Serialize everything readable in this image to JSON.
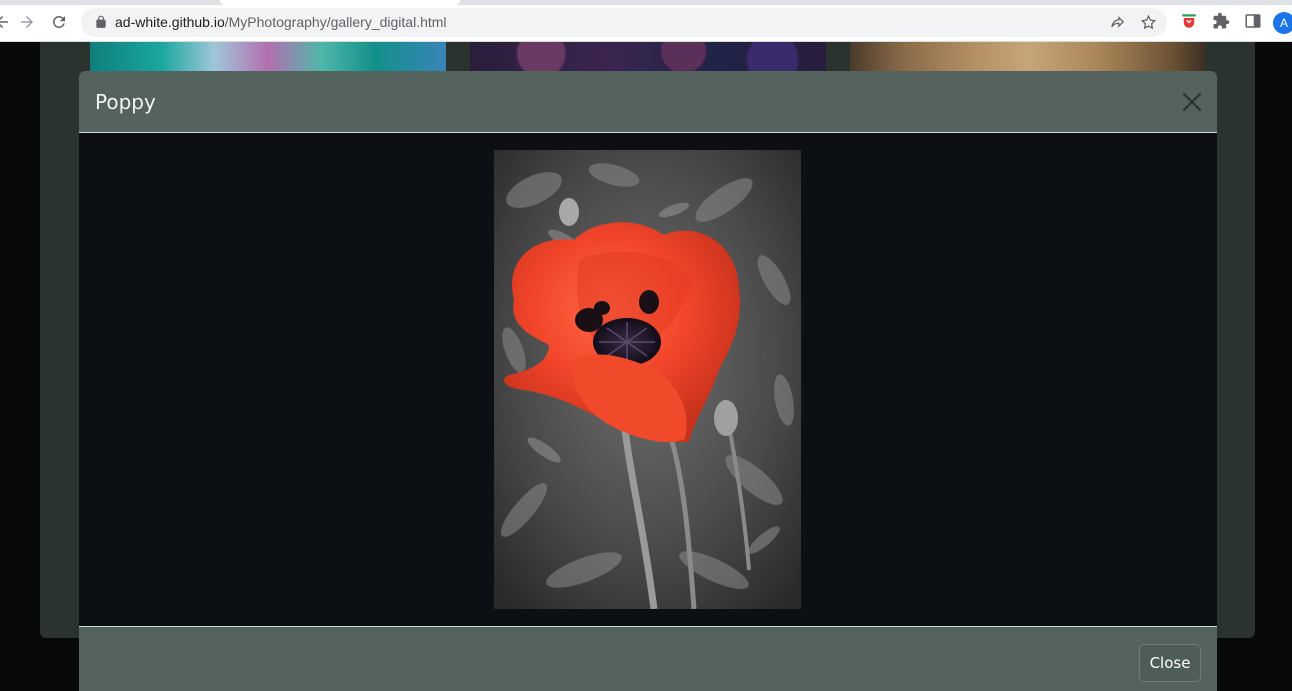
{
  "browser": {
    "url_host": "ad-white.github.io",
    "url_path": "/MyPhotography/gallery_digital.html",
    "profile_initial": "A",
    "icons": [
      "back-icon",
      "forward-icon",
      "reload-icon",
      "lock-icon",
      "share-icon",
      "bookmark-star-icon",
      "extension-shield-icon",
      "extensions-puzzle-icon",
      "side-panel-icon"
    ]
  },
  "modal": {
    "title": "Poppy",
    "close_button_label": "Close",
    "photo_subject": "red poppy on black-and-white foliage"
  },
  "colors": {
    "modal_header_bg": "#54635d",
    "modal_body_bg": "#0c1014",
    "page_bg": "#07090b",
    "poppy_red": "#f04a2a"
  }
}
